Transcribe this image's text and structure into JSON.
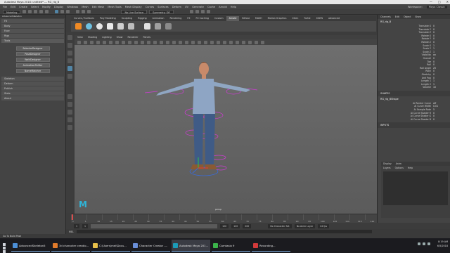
{
  "window": {
    "title": "Autodesk Maya 2018: untitled*   ---   RG_rig_B",
    "controls": [
      "—",
      "□",
      "✕"
    ]
  },
  "menubar": {
    "items": [
      "File",
      "Edit",
      "Create",
      "Select",
      "Modify",
      "Display",
      "Windows",
      "Mesh",
      "Edit Mesh",
      "Mesh Tools",
      "Mesh Display",
      "Curves",
      "Surfaces",
      "Deform",
      "UV",
      "Generate",
      "Cache",
      "Arnold",
      "Help"
    ],
    "workspace_label": "Workspace:",
    "workspace_value": "Maya Classic"
  },
  "statusline": {
    "mode": "Modeling",
    "live_surface": "No Live Surface",
    "symmetry": "Symmetry: Off"
  },
  "shelf": {
    "tabs": [
      "Curves / Surfaces",
      "Poly Modeling",
      "Sculpting",
      "Rigging",
      "Animation",
      "Rendering",
      "FX",
      "FX Caching",
      "Custom",
      "Arnold",
      "Bifrost",
      "MASH",
      "Motion Graphics",
      "XGen",
      "Turtle",
      "XGEN",
      "advanced"
    ],
    "active_tab": "Arnold"
  },
  "outliner": {
    "header": "AdvancedSkeleton",
    "sections": [
      "Fit",
      "Body",
      "Face",
      "Rigs"
    ],
    "tools_section": "Tools",
    "buttons": [
      "SelectorDesigner",
      "PoseDesigner",
      "WalkDesigner",
      "AnimationShifter",
      "NameMatcher"
    ],
    "lower_sections": [
      "Skeleton",
      "Deform",
      "Publish",
      "Stats",
      "About"
    ],
    "footer": "Go To Build Pose"
  },
  "panel": {
    "menu": [
      "View",
      "Shading",
      "Lighting",
      "Show",
      "Renderer",
      "Panels"
    ],
    "camera": "persp"
  },
  "channelbox": {
    "tabs": [
      "Channels",
      "Edit",
      "Object",
      "Show"
    ],
    "object": "RG_rig_B",
    "attributes": [
      {
        "name": "Translate X",
        "value": "0"
      },
      {
        "name": "Translate Y",
        "value": "0"
      },
      {
        "name": "Translate Z",
        "value": "0"
      },
      {
        "name": "Rotate X",
        "value": "0"
      },
      {
        "name": "Rotate Y",
        "value": "0"
      },
      {
        "name": "Rotate Z",
        "value": "0"
      },
      {
        "name": "Scale X",
        "value": "1"
      },
      {
        "name": "Scale Y",
        "value": "1"
      },
      {
        "name": "Scale Z",
        "value": "1"
      },
      {
        "name": "Visibility",
        "value": "on"
      },
      {
        "name": "Overall",
        "value": "0"
      },
      {
        "name": "Toe",
        "value": "0"
      },
      {
        "name": "Roll",
        "value": "0"
      },
      {
        "name": "Roll Angle",
        "value": "25"
      },
      {
        "name": "Rock",
        "value": "0"
      },
      {
        "name": "Stretchy",
        "value": "0"
      },
      {
        "name": "Anti Pop",
        "value": "0"
      },
      {
        "name": "Length 1",
        "value": "1"
      },
      {
        "name": "Length 2",
        "value": "1"
      },
      {
        "name": "Volume",
        "value": "10"
      }
    ],
    "shapes_label": "SHAPES",
    "shape_name": "RG_rig_BShape",
    "shape_attributes": [
      {
        "name": "Ai Render Curve",
        "value": "off"
      },
      {
        "name": "Ai Curve Width",
        "value": "0.01"
      },
      {
        "name": "Ai Sample Rate",
        "value": "5"
      },
      {
        "name": "Ai Curve Shader R",
        "value": "0"
      },
      {
        "name": "Ai Curve Shader G",
        "value": "0"
      },
      {
        "name": "Ai Curve Shader B",
        "value": "0"
      }
    ],
    "inputs_label": "INPUTS"
  },
  "layers": {
    "tabs": [
      "Display",
      "Anim"
    ],
    "menu": [
      "Layers",
      "Options",
      "Help"
    ]
  },
  "timeline": {
    "ticks": [
      "1",
      "5",
      "10",
      "15",
      "20",
      "25",
      "30",
      "35",
      "40",
      "45",
      "50",
      "55",
      "60",
      "65",
      "70",
      "75",
      "80",
      "85",
      "90",
      "95",
      "100",
      "105",
      "110",
      "115",
      "120"
    ],
    "current_frame": "1"
  },
  "range": {
    "start": "1",
    "inner_start": "1",
    "inner_end": "120",
    "end": "120",
    "outer_end": "200",
    "character_set": "No Character Set",
    "anim_layer": "No Anim Layer",
    "fps": "24 fps"
  },
  "commandline": {
    "label": "MEL"
  },
  "helpline": {
    "text": "Go To Build Pose"
  },
  "taskbar": {
    "tasks": [
      {
        "label": "AdvancedSkeleton5",
        "color": "#4c8fd6"
      },
      {
        "label": "3d character creatio...",
        "color": "#e07b2b"
      },
      {
        "label": "C:\\Users\\mel\\Docu...",
        "color": "#e8c04a"
      },
      {
        "label": "Character Creator -...",
        "color": "#6a8fd8"
      },
      {
        "label": "Autodesk Maya 201...",
        "color": "#1b9bb8"
      },
      {
        "label": "Camtasia 9",
        "color": "#3bb34a"
      },
      {
        "label": "Recording...",
        "color": "#d23a3a"
      }
    ],
    "time": "8:19 AM",
    "date": "6/5/2018"
  },
  "colors": {
    "accent": "#5285a6",
    "maya_logo": "#2fb4d8",
    "rig_controls": "#d03bd6"
  }
}
